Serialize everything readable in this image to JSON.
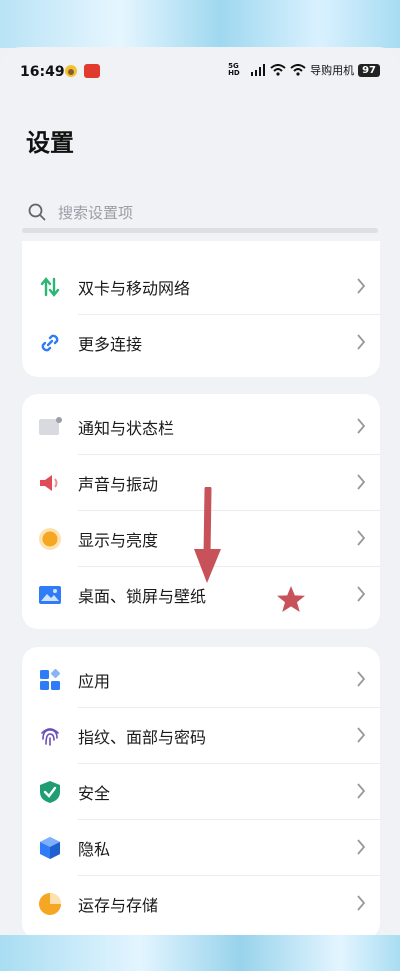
{
  "status_bar": {
    "time": "16:49",
    "network": "5G HD",
    "carrier": "导购用机",
    "battery": "97"
  },
  "page": {
    "title": "设置"
  },
  "search": {
    "placeholder": "搜索设置项"
  },
  "group1": [
    {
      "label": "双卡与移动网络",
      "icon": "dual-sim-icon"
    },
    {
      "label": "更多连接",
      "icon": "link-icon"
    }
  ],
  "group2": [
    {
      "label": "通知与状态栏",
      "icon": "notification-icon"
    },
    {
      "label": "声音与振动",
      "icon": "speaker-icon"
    },
    {
      "label": "显示与亮度",
      "icon": "brightness-icon"
    },
    {
      "label": "桌面、锁屏与壁纸",
      "icon": "wallpaper-icon"
    }
  ],
  "group3": [
    {
      "label": "应用",
      "icon": "apps-icon"
    },
    {
      "label": "指纹、面部与密码",
      "icon": "fingerprint-icon"
    },
    {
      "label": "安全",
      "icon": "shield-icon"
    },
    {
      "label": "隐私",
      "icon": "privacy-icon"
    },
    {
      "label": "运存与存储",
      "icon": "storage-icon"
    }
  ],
  "colors": {
    "green": "#2bb673",
    "blue": "#2f7cf6",
    "red": "#e04b57",
    "orange": "#f5a623",
    "annotation": "#c8525a"
  }
}
